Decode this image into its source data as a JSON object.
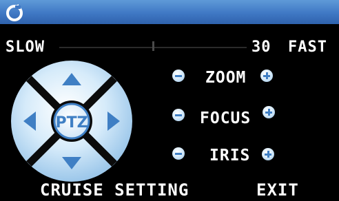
{
  "speed": {
    "slow_label": "SLOW",
    "value": "30",
    "fast_label": "FAST",
    "level": 0.5
  },
  "ptz": {
    "center_label": "PTZ",
    "icons": [
      "arrow-up-icon",
      "arrow-down-icon",
      "arrow-left-icon",
      "arrow-right-icon"
    ]
  },
  "controls": [
    {
      "label": "ZOOM"
    },
    {
      "label": "FOCUS"
    },
    {
      "label": "IRIS"
    }
  ],
  "bottom": {
    "cruise_label": "CRUISE SETTING",
    "exit_label": "EXIT"
  },
  "colors": {
    "titlebar": "#3f78c4",
    "background": "#000000",
    "accent": "#3f7fc4",
    "pad": "#c6e0f5"
  }
}
